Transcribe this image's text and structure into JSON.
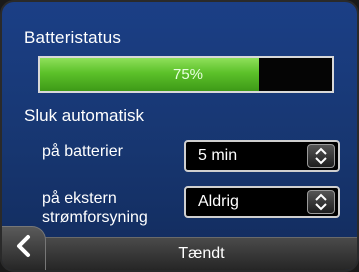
{
  "battery": {
    "title": "Batteristatus",
    "level_percent": 75,
    "level_label": "75%"
  },
  "auto_off": {
    "title": "Sluk automatisk",
    "on_battery": {
      "label": "på batterier",
      "value": "5 min"
    },
    "on_external": {
      "label_line1": "på ekstern",
      "label_line2": "strømforsyning",
      "value": "Aldrig"
    }
  },
  "footer": {
    "status_label": "Tændt",
    "back_icon": "chevron-left-icon"
  },
  "colors": {
    "background": "#173670",
    "battery_fill": "#5cc12a",
    "select_bg": "#000000"
  }
}
